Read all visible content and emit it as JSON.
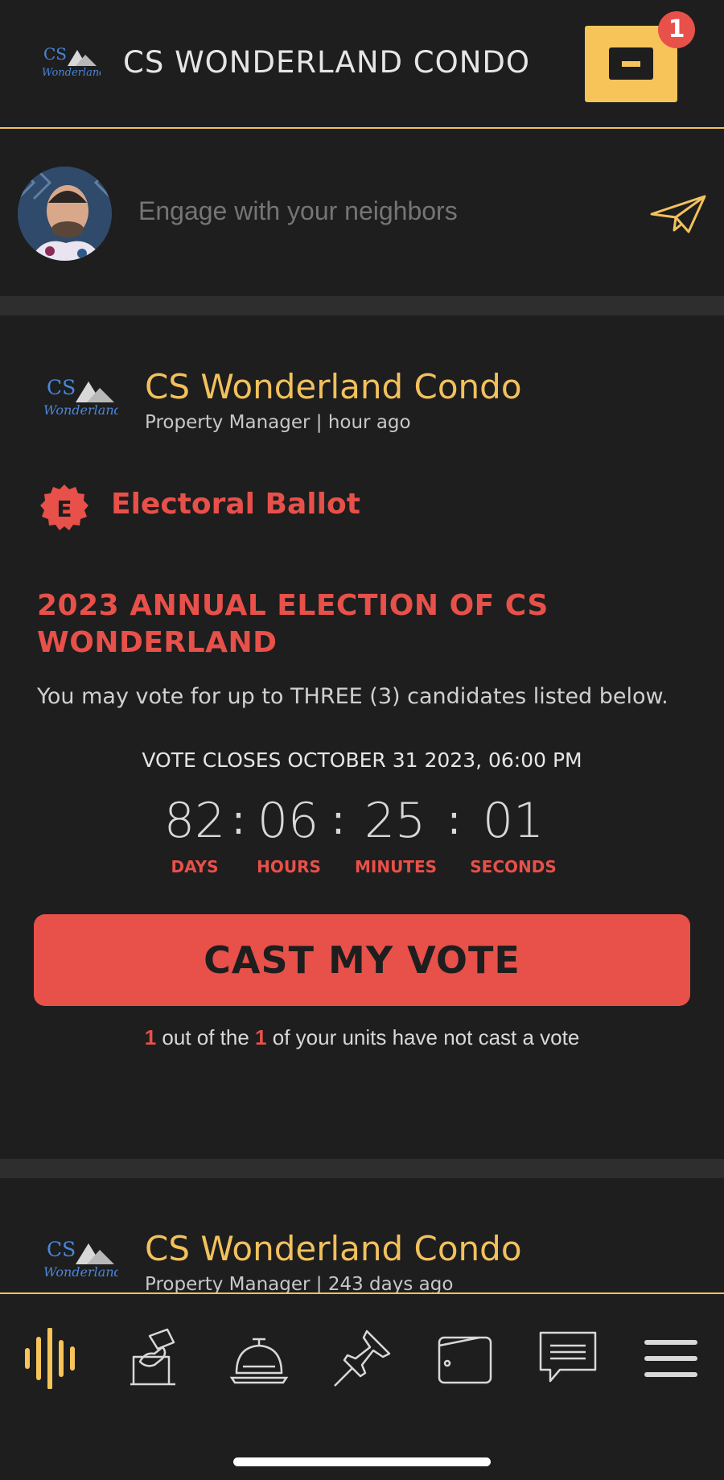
{
  "header": {
    "title": "CS WONDERLAND CONDO",
    "notification_count": "1",
    "logo_icon": "cs-wonderland-logo",
    "accent": "#f7c45a"
  },
  "composer": {
    "placeholder": "Engage with your neighbors",
    "send_icon": "paper-plane-icon"
  },
  "post": {
    "author": "CS Wonderland Condo",
    "meta": "Property Manager | hour ago",
    "ballot_badge_letter": "E",
    "ballot_type": "Electoral Ballot",
    "election_title": "2023 ANNUAL ELECTION OF CS WONDERLAND",
    "description": "You may vote for up to THREE (3) candidates listed below.",
    "vote_closes": "VOTE CLOSES OCTOBER 31 2023, 06:00 PM",
    "countdown": {
      "days": "82",
      "hours": "06",
      "minutes": "25",
      "seconds": "01",
      "days_label": "DAYS",
      "hours_label": "HOURS",
      "minutes_label": "MINUTES",
      "seconds_label": "SECONDS",
      "separator": ":"
    },
    "cast_button": "CAST MY VOTE",
    "units_note": {
      "count": "1",
      "text1": " out of the ",
      "total": "1",
      "text2": " of your units have not cast a vote"
    },
    "accent_red": "#e8504a"
  },
  "post2": {
    "author": "CS Wonderland Condo",
    "meta": "Property Manager | 243 days ago"
  },
  "bottom_nav": {
    "items": [
      "audio-wave-icon",
      "ballot-box-icon",
      "service-bell-icon",
      "push-pin-icon",
      "wallet-icon",
      "chat-icon",
      "menu-icon"
    ],
    "active_color": "#f7c45a"
  }
}
